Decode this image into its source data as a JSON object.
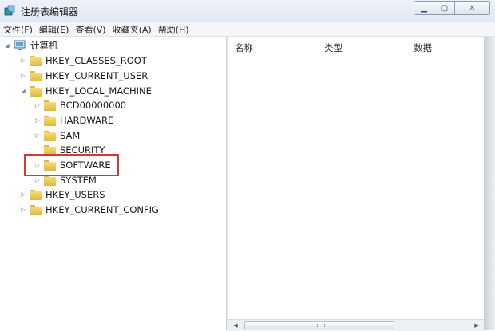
{
  "window": {
    "title": "注册表编辑器"
  },
  "menu": [
    "文件(F)",
    "编辑(E)",
    "查看(V)",
    "收藏夹(A)",
    "帮助(H)"
  ],
  "tree": {
    "root_label": "计算机",
    "nodes": [
      {
        "label": "HKEY_CLASSES_ROOT",
        "expander": "▷"
      },
      {
        "label": "HKEY_CURRENT_USER",
        "expander": "▷"
      },
      {
        "label": "HKEY_LOCAL_MACHINE",
        "expander": "◢"
      },
      {
        "label": "BCD00000000",
        "expander": "▷"
      },
      {
        "label": "HARDWARE",
        "expander": "▷"
      },
      {
        "label": "SAM",
        "expander": "▷"
      },
      {
        "label": "SECURITY",
        "expander": ""
      },
      {
        "label": "SOFTWARE",
        "expander": "▷"
      },
      {
        "label": "SYSTEM",
        "expander": "▷"
      },
      {
        "label": "HKEY_USERS",
        "expander": "▷"
      },
      {
        "label": "HKEY_CURRENT_CONFIG",
        "expander": "▷"
      }
    ],
    "highlighted_node": "SOFTWARE",
    "highlight_color": "#d23a3a"
  },
  "list": {
    "columns": [
      "名称",
      "类型",
      "数据"
    ]
  },
  "icons": {
    "app": "regedit-icon",
    "computer": "computer-icon",
    "folder": "folder-icon"
  }
}
